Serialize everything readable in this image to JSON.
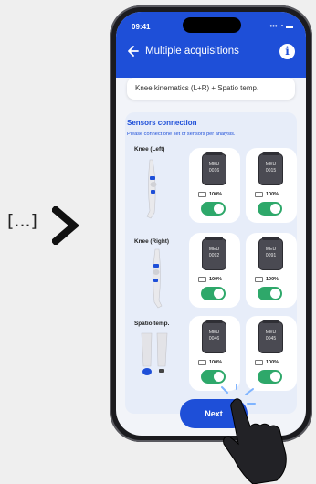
{
  "side": {
    "ellipsis": "[...]"
  },
  "status": {
    "time": "09:41",
    "icons": "••• ◔ ▬"
  },
  "header": {
    "title": "Multiple acquisitions",
    "info": "i"
  },
  "analysis_field": {
    "value": "Knee kinematics (L+R) + Spatio temp."
  },
  "sensors": {
    "title": "Sensors connection",
    "subtitle": "Please connect one set of sensors per analysis.",
    "rows": [
      {
        "label": "Knee (Left)",
        "sensors": [
          {
            "line1": "MEU",
            "line2": "0016",
            "battery": "100%",
            "connected": true
          },
          {
            "line1": "MEU",
            "line2": "0015",
            "battery": "100%",
            "connected": true
          }
        ]
      },
      {
        "label": "Knee (Right)",
        "sensors": [
          {
            "line1": "MEU",
            "line2": "0092",
            "battery": "100%",
            "connected": true
          },
          {
            "line1": "MEU",
            "line2": "0091",
            "battery": "100%",
            "connected": true
          }
        ]
      },
      {
        "label": "Spatio temp.",
        "sensors": [
          {
            "line1": "MEU",
            "line2": "0046",
            "battery": "100%",
            "connected": true
          },
          {
            "line1": "MEU",
            "line2": "0045",
            "battery": "100%",
            "connected": true
          }
        ]
      }
    ]
  },
  "next_button": {
    "label": "Next"
  },
  "colors": {
    "brand_blue": "#1e4fd8",
    "toggle_on": "#2ea86a",
    "card_bg": "#e7edf9"
  }
}
